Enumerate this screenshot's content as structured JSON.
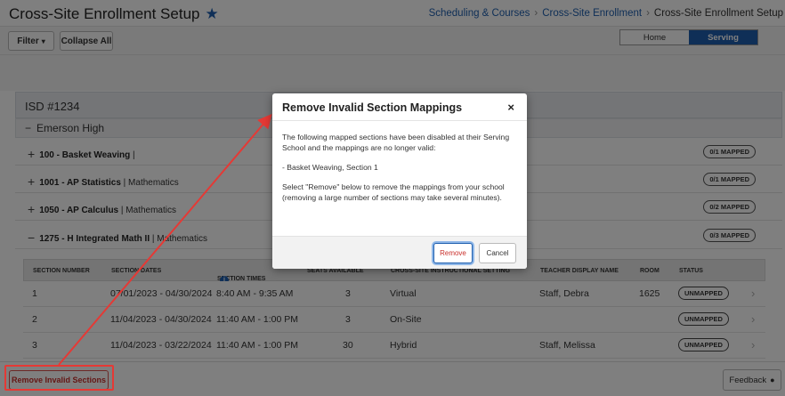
{
  "header": {
    "title": "Cross-Site Enrollment Setup",
    "breadcrumb": [
      "Scheduling & Courses",
      "Cross-Site Enrollment",
      "Cross-Site Enrollment Setup"
    ]
  },
  "toolbar": {
    "filter_label": "Filter",
    "collapse_label": "Collapse All",
    "toggle": [
      "Home",
      "Serving"
    ]
  },
  "district": "ISD #1234",
  "school": "Emerson High",
  "courses": [
    {
      "number": "100 - Basket Weaving",
      "dept": " | ",
      "badge": "0/1 MAPPED",
      "symbol": "+"
    },
    {
      "number": "1001 - AP Statistics",
      "dept": " | Mathematics",
      "badge": "0/1 MAPPED",
      "symbol": "+"
    },
    {
      "number": "1050 - AP Calculus",
      "dept": " | Mathematics",
      "badge": "0/2 MAPPED",
      "symbol": "+"
    },
    {
      "number": "1275 - H Integrated Math II",
      "dept": " | Mathematics",
      "badge": "0/3 MAPPED",
      "symbol": "−"
    }
  ],
  "table": {
    "headers": [
      "SECTION NUMBER",
      "SECTION DATES",
      "SECTION TIMES",
      "SEATS AVAILABLE",
      "CROSS-SITE INSTRUCTIONAL SETTING",
      "TEACHER DISPLAY NAME",
      "ROOM",
      "STATUS"
    ],
    "rows": [
      [
        "1",
        "07/01/2023 - 04/30/2024",
        "8:40 AM - 9:35 AM",
        "3",
        "Virtual",
        "Staff, Debra",
        "1625",
        "UNMAPPED"
      ],
      [
        "2",
        "11/04/2023 - 04/30/2024",
        "11:40 AM - 1:00 PM",
        "3",
        "On-Site",
        "",
        "",
        "UNMAPPED"
      ],
      [
        "3",
        "11/04/2023 - 03/22/2024",
        "11:40 AM - 1:00 PM",
        "30",
        "Hybrid",
        "Staff, Melissa",
        "",
        "UNMAPPED"
      ]
    ]
  },
  "bottom": {
    "remove_invalid_label": "Remove Invalid Sections",
    "feedback_label": "Feedback"
  },
  "modal": {
    "title": "Remove Invalid Section Mappings",
    "close": "×",
    "para1": "The following mapped sections have been disabled at their Serving School and the mappings are no longer valid:",
    "para2": "- Basket Weaving, Section 1",
    "para3": "Select \"Remove\" below to remove the mappings from your school (removing a large number of sections may take several minutes).",
    "remove_label": "Remove",
    "cancel_label": "Cancel"
  },
  "colors": {
    "accent": "#1f5fae",
    "danger": "#c9302c",
    "annotation": "#e53935"
  }
}
